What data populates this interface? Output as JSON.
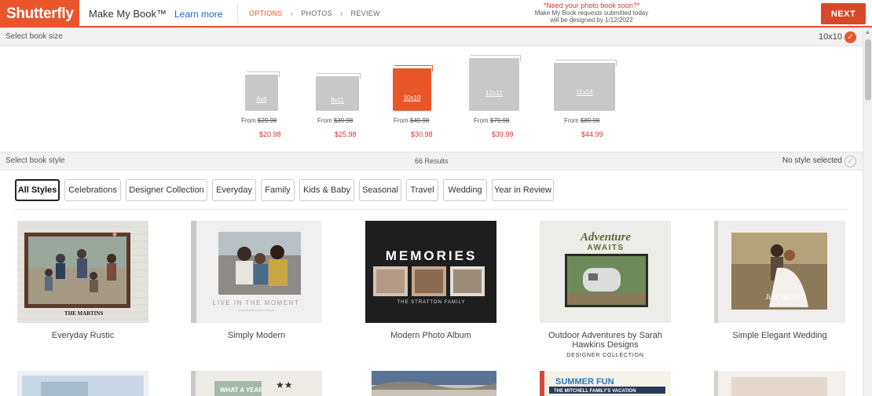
{
  "header": {
    "logo": "Shutterfly",
    "product": "Make My Book™",
    "learn_more": "Learn more",
    "steps": [
      "OPTIONS",
      "PHOTOS",
      "REVIEW"
    ],
    "notice_line1": "*Need your photo book soon?*",
    "notice_line2": "Make My Book requests submitted today",
    "notice_line3": "will be designed by 1/12/2022",
    "next": "NEXT"
  },
  "size_section": {
    "label": "Select book size",
    "selected": "10x10",
    "sizes": [
      {
        "label": "8x8",
        "from": "From",
        "was": "$29.98",
        "price": "$20.98"
      },
      {
        "label": "8x11",
        "from": "From",
        "was": "$39.98",
        "price": "$25.98"
      },
      {
        "label": "10x10",
        "from": "From",
        "was": "$49.98",
        "price": "$30.98"
      },
      {
        "label": "12x12",
        "from": "From",
        "was": "$79.98",
        "price": "$39.99"
      },
      {
        "label": "11x14",
        "from": "From",
        "was": "$89.98",
        "price": "$44.99"
      }
    ]
  },
  "style_section": {
    "label": "Select book style",
    "results": "66 Results",
    "selected": "No style selected",
    "filters": [
      "All Styles",
      "Celebrations",
      "Designer Collection",
      "Everyday",
      "Family",
      "Kids & Baby",
      "Seasonal",
      "Travel",
      "Wedding",
      "Year in Review"
    ]
  },
  "cards": [
    {
      "title": "Everyday Rustic",
      "cover_text": "THE MARTINS"
    },
    {
      "title": "Simply Modern",
      "cover_text": "LIVE IN THE MOMENT"
    },
    {
      "title": "Modern Photo Album",
      "cover_text": "MEMORIES",
      "cover_sub": "THE STRATTON FAMILY"
    },
    {
      "title": "Outdoor Adventures by Sarah Hawkins Designs",
      "badge": "DESIGNER COLLECTION",
      "cover_text": "Adventure",
      "cover_sub": "AWAITS"
    },
    {
      "title": "Simple Elegant Wedding",
      "cover_text": "Just married"
    }
  ],
  "cards_row2": [
    {
      "cover_text": ""
    },
    {
      "cover_text": "WHAT A YEAR"
    },
    {
      "cover_text": ""
    },
    {
      "cover_text": "SUMMER FUN",
      "cover_sub": "THE MITCHELL FAMILY'S VACATION"
    },
    {
      "cover_text": ""
    }
  ],
  "colors": {
    "brand": "#e8562a",
    "price": "#dd3333",
    "link": "#1b66c9"
  }
}
